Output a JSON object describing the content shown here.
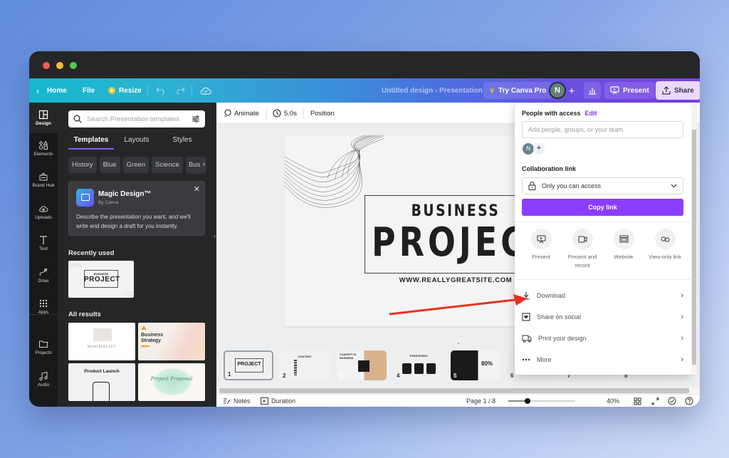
{
  "window": {
    "controls": [
      "close",
      "minimize",
      "maximize"
    ]
  },
  "topbar": {
    "home": "Home",
    "file": "File",
    "resize": "Resize",
    "doc_title": "Untitled design - Presentation",
    "try_pro": "Try Canva Pro",
    "avatar_initial": "N",
    "add_people": "+",
    "present": "Present",
    "share": "Share",
    "gradient_colors": [
      "#14b8cd",
      "#3a8fd8",
      "#7b3fe4"
    ]
  },
  "rail": {
    "items": [
      {
        "label": "Design",
        "icon": "layout-icon",
        "active": true
      },
      {
        "label": "Elements",
        "icon": "shapes-icon"
      },
      {
        "label": "Brand Hub",
        "icon": "brand-icon"
      },
      {
        "label": "Uploads",
        "icon": "cloud-upload-icon"
      },
      {
        "label": "Text",
        "icon": "text-icon"
      },
      {
        "label": "Draw",
        "icon": "draw-icon"
      },
      {
        "label": "Apps",
        "icon": "apps-icon"
      },
      {
        "label": "Projects",
        "icon": "folder-icon"
      },
      {
        "label": "Audio",
        "icon": "music-icon"
      }
    ]
  },
  "panel": {
    "search_placeholder": "Search Presentation templates",
    "tabs": [
      "Templates",
      "Layouts",
      "Styles"
    ],
    "active_tab": "Templates",
    "chips": [
      "History",
      "Blue",
      "Green",
      "Science",
      "Bus"
    ],
    "magic": {
      "title": "Magic Design™",
      "by": "By Canva",
      "description": "Describe the presentation you want, and we'll write and design a draft for you instantly."
    },
    "recently_used_heading": "Recently used",
    "recent": [
      {
        "title": "BUSINESS",
        "subtitle": "PROJECT"
      }
    ],
    "all_results_heading": "All results",
    "results": [
      {
        "title": "MINIMALIST"
      },
      {
        "title": "Business Strategy"
      },
      {
        "title": "Product Launch"
      },
      {
        "title": "Project Proposal"
      }
    ]
  },
  "context_bar": {
    "animate": "Animate",
    "duration": "5.0s",
    "position": "Position"
  },
  "slide": {
    "line1": "BUSINESS",
    "line2": "PROJECT",
    "url": "WWW.REALLYGREATSITE.COM"
  },
  "filmstrip": {
    "pages": [
      {
        "num": "1",
        "title": "PROJECT",
        "selected": true
      },
      {
        "num": "2",
        "title": "CONTENT"
      },
      {
        "num": "3",
        "title": "CONCEPT IN BUSINESS"
      },
      {
        "num": "4",
        "title": "STRATEGIES"
      },
      {
        "num": "5",
        "title": "80%"
      },
      {
        "num": "6",
        "title": ""
      },
      {
        "num": "7",
        "title": ""
      },
      {
        "num": "8",
        "title": ""
      }
    ]
  },
  "footer": {
    "notes": "Notes",
    "duration": "Duration",
    "page_indicator": "Page 1 / 8",
    "zoom_value_percent": 40,
    "zoom_label": "40%"
  },
  "share_panel": {
    "people_heading": "People with access",
    "edit": "Edit",
    "add_placeholder": "Add people, groups, or your team",
    "member_initial": "N",
    "collab_heading": "Collaboration link",
    "access_value": "Only you can access",
    "copy_link": "Copy link",
    "quick_options": [
      {
        "label": "Present",
        "icon": "present-icon"
      },
      {
        "label": "Present and record",
        "icon": "camera-icon"
      },
      {
        "label": "Website",
        "icon": "website-icon"
      },
      {
        "label": "View-only link",
        "icon": "link-icon"
      }
    ],
    "actions": [
      {
        "label": "Download",
        "icon": "download-icon"
      },
      {
        "label": "Share on social",
        "icon": "social-icon"
      },
      {
        "label": "Print your design",
        "icon": "truck-icon"
      },
      {
        "label": "More",
        "icon": "more-icon"
      }
    ],
    "accent_color": "#8b3dff"
  },
  "annotation": {
    "arrow_color": "#e8321f",
    "points_to": "Download"
  }
}
